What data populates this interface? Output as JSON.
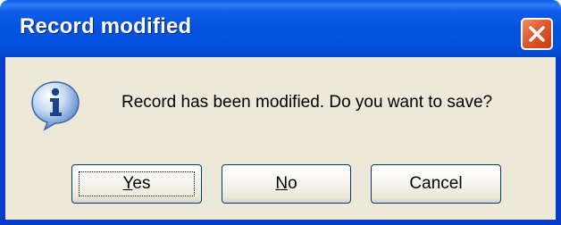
{
  "window": {
    "title": "Record modified",
    "close_icon": "close-icon"
  },
  "dialog": {
    "icon": "info-icon",
    "message": "Record has been modified.  Do you want to save?"
  },
  "buttons": {
    "yes": {
      "mnemonic": "Y",
      "rest": "es",
      "default": true
    },
    "no": {
      "mnemonic": "N",
      "rest": "o"
    },
    "cancel": {
      "label": "Cancel"
    }
  },
  "colors": {
    "titlebar": "#0453e0",
    "client": "#ece9d8",
    "close_button": "#e25a2f"
  }
}
